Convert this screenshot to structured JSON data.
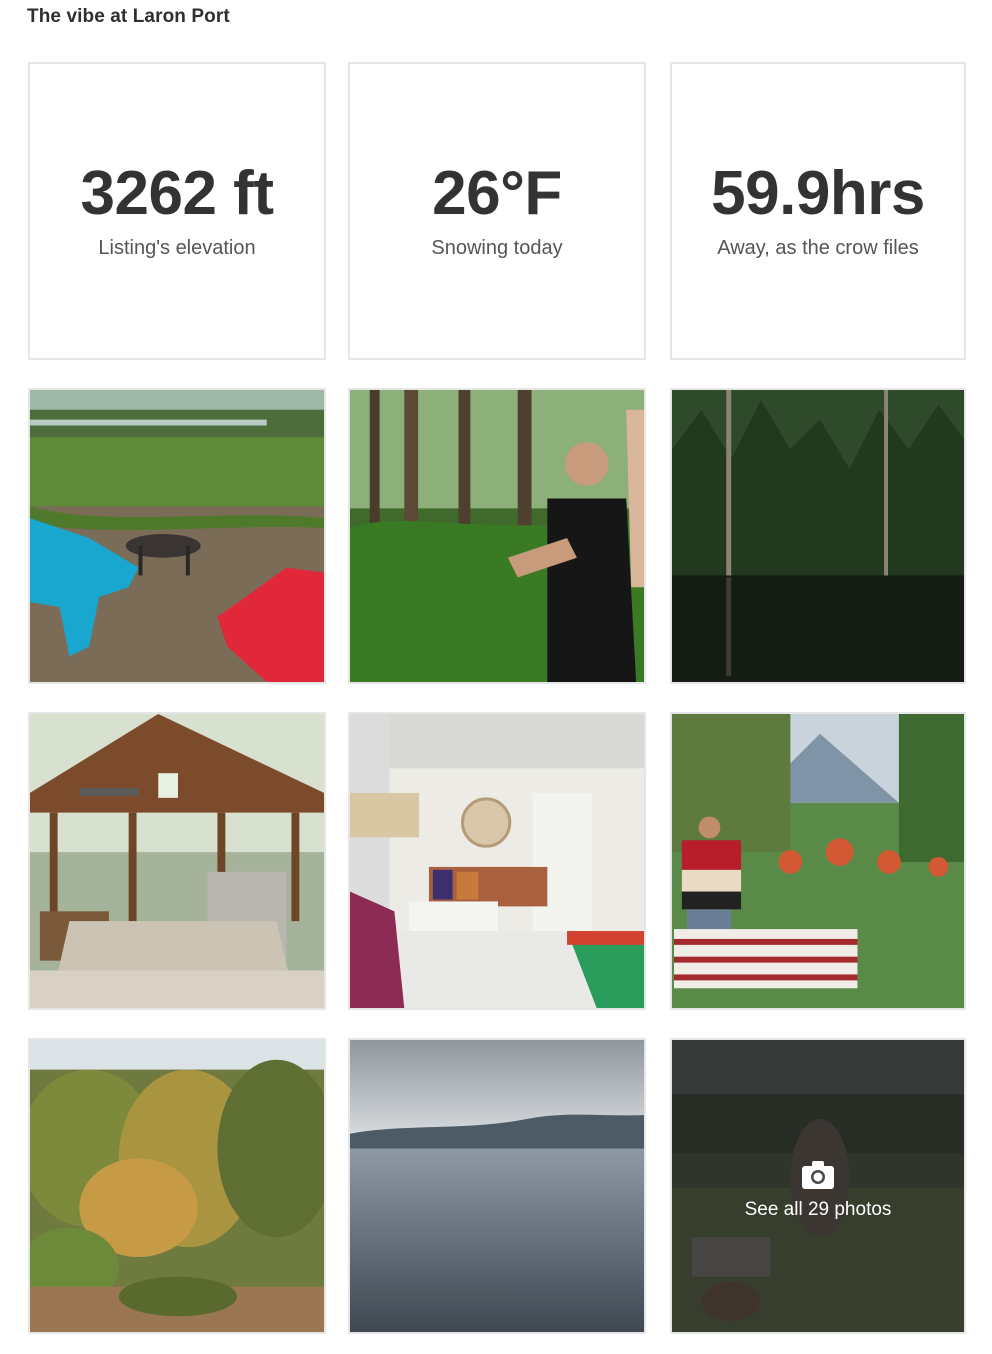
{
  "section": {
    "title": "The vibe at Laron Port"
  },
  "stats": [
    {
      "value": "3262 ft",
      "caption": "Listing's elevation"
    },
    {
      "value": "26°F",
      "caption": "Snowing today"
    },
    {
      "value": "59.9hrs",
      "caption": "Away, as the crow files"
    }
  ],
  "photos": [
    "campfire-adirondack-chairs-photo",
    "man-in-forest-photo",
    "forest-pond-reflection-photo",
    "campground-pavilion-photo",
    "cozy-bedroom-photo",
    "woman-picnic-table-photo",
    "overgrown-shrubs-photo",
    "cloudy-lake-photo",
    "farm-animals-photo"
  ],
  "see_all": {
    "label": "See all 29 photos",
    "icon": "camera-icon"
  }
}
